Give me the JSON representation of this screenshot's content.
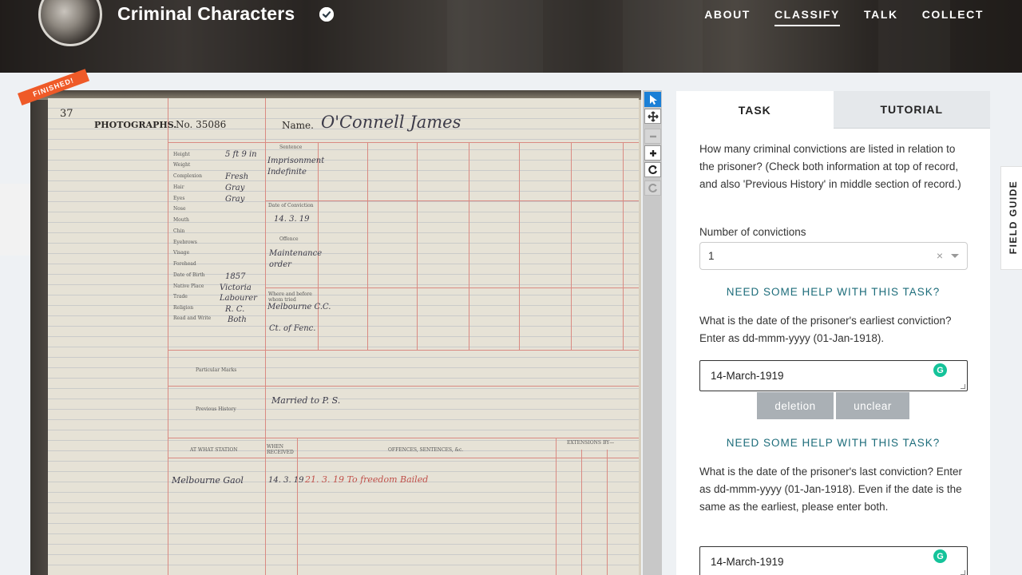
{
  "header": {
    "title": "Criminal Characters",
    "nav": [
      "ABOUT",
      "CLASSIFY",
      "TALK",
      "COLLECT"
    ],
    "active_nav": "CLASSIFY"
  },
  "viewer": {
    "badge": "FINISHED!",
    "document": {
      "page_number": "37",
      "photographs_label": "PHOTOGRAPHS.",
      "number": "No. 35086",
      "name_label": "Name.",
      "name_value": "O'Connell James",
      "fields": [
        "Height",
        "Weight",
        "Complexion",
        "Hair",
        "Eyes",
        "Nose",
        "Mouth",
        "Chin",
        "Eyebrows",
        "Visage",
        "Forehead",
        "Date of Birth",
        "Native Place",
        "Trade",
        "Religion",
        "Read and Write"
      ],
      "field_values": [
        "5 ft 9 in",
        "",
        "Fresh",
        "Gray",
        "Gray",
        "",
        "",
        "",
        "",
        "",
        "",
        "1857",
        "Victoria",
        "Labourer",
        "R. C.",
        "Both"
      ],
      "sentence_label": "Sentence",
      "sentence_value": "Imprisonment Indefinite",
      "date_conviction_label": "Date of Conviction",
      "date_conviction_value": "14. 3. 19",
      "offence_label": "Offence",
      "offence_value": "Maintenance order",
      "where_tried_label": "Where and before whom tried",
      "where_tried_value": "Melbourne C.C.",
      "ct_label": "Ct. of Fenc.",
      "particular_marks_label": "Particular Marks",
      "previous_history_label": "Previous History",
      "previous_history_value": "Married to P. S.",
      "table_headers": [
        "AT WHAT STATION",
        "WHEN RECEIVED",
        "OFFENCES, SENTENCES, &c.",
        "EXTENSIONS BY—"
      ],
      "table_row": [
        "Melbourne Gaol",
        "14. 3. 19",
        "21. 3. 19  To freedom Bailed"
      ]
    }
  },
  "toolbar": {
    "tools": [
      "pointer-icon",
      "move-icon",
      "zoom-out-icon",
      "zoom-in-icon",
      "rotate-icon",
      "reset-icon"
    ]
  },
  "panel": {
    "tabs": [
      "TASK",
      "TUTORIAL"
    ],
    "q1": "How many criminal convictions are listed in relation to the prisoner? (Check both information at top of record, and also 'Previous History' in middle section of record.)",
    "q1_label": "Number of convictions",
    "q1_value": "1",
    "help": "NEED SOME HELP WITH THIS TASK?",
    "q2": "What is the date of the prisoner's earliest conviction? Enter as dd-mmm-yyyy (01-Jan-1918).",
    "q2_value": "14-March-1919",
    "deletion": "deletion",
    "unclear": "unclear",
    "q3": "What is the date of the prisoner's last conviction? Enter as dd-mmm-yyyy (01-Jan-1918). Even if the date is the same as the earliest, please enter both.",
    "q3_value": "14-March-1919",
    "field_guide": "FIELD GUIDE"
  }
}
